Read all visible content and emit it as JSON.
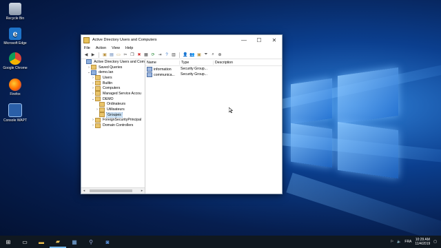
{
  "desktop": {
    "icons": [
      {
        "label": "Recycle Bin",
        "icon": "recycle-bin-icon"
      },
      {
        "label": "Microsoft Edge",
        "icon": "edge-icon"
      },
      {
        "label": "Google Chrome",
        "icon": "chrome-icon"
      },
      {
        "label": "Firefox",
        "icon": "firefox-icon"
      },
      {
        "label": "Console WAPT",
        "icon": "wapt-icon"
      }
    ]
  },
  "window": {
    "title": "Active Directory Users and Computers",
    "minimize": "—",
    "maximize": "☐",
    "close": "✕"
  },
  "menu": [
    "File",
    "Action",
    "View",
    "Help"
  ],
  "tree": {
    "items": [
      {
        "label": "Active Directory Users and Com",
        "level": 0,
        "expander": "",
        "icon": "blue"
      },
      {
        "label": "Saved Queries",
        "level": 1,
        "expander": "›",
        "icon": "yellow"
      },
      {
        "label": "demo.lan",
        "level": 1,
        "expander": "⌄",
        "icon": "blue"
      },
      {
        "label": "Users",
        "level": 2,
        "expander": "›",
        "icon": "yellow"
      },
      {
        "label": "Builtin",
        "level": 2,
        "expander": "›",
        "icon": "yellow"
      },
      {
        "label": "Computers",
        "level": 2,
        "expander": "›",
        "icon": "yellow"
      },
      {
        "label": "Managed Service Accou",
        "level": 2,
        "expander": "›",
        "icon": "yellow"
      },
      {
        "label": "DEMO",
        "level": 2,
        "expander": "⌄",
        "icon": "yellow"
      },
      {
        "label": "Ordinateurs",
        "level": 3,
        "expander": "",
        "icon": "yellow"
      },
      {
        "label": "Utilisateurs",
        "level": 3,
        "expander": "›",
        "icon": "yellow"
      },
      {
        "label": "Groupes",
        "level": 3,
        "expander": "",
        "icon": "yellow",
        "selected": true
      },
      {
        "label": "ForeignSecurityPrincipal",
        "level": 2,
        "expander": "›",
        "icon": "yellow"
      },
      {
        "label": "Domain Controllers",
        "level": 2,
        "expander": "›",
        "icon": "yellow"
      }
    ],
    "scroll_left": "◂",
    "scroll_right": "▸"
  },
  "details": {
    "columns": [
      "Name",
      "Type",
      "Description"
    ],
    "rows": [
      {
        "name": "information",
        "type": "Security Group...",
        "description": ""
      },
      {
        "name": "communica...",
        "type": "Security Group...",
        "description": ""
      }
    ]
  },
  "taskbar": {
    "start": "⊞",
    "language": "FRA",
    "time": "10:29 AM",
    "date": "11/4/2019"
  }
}
